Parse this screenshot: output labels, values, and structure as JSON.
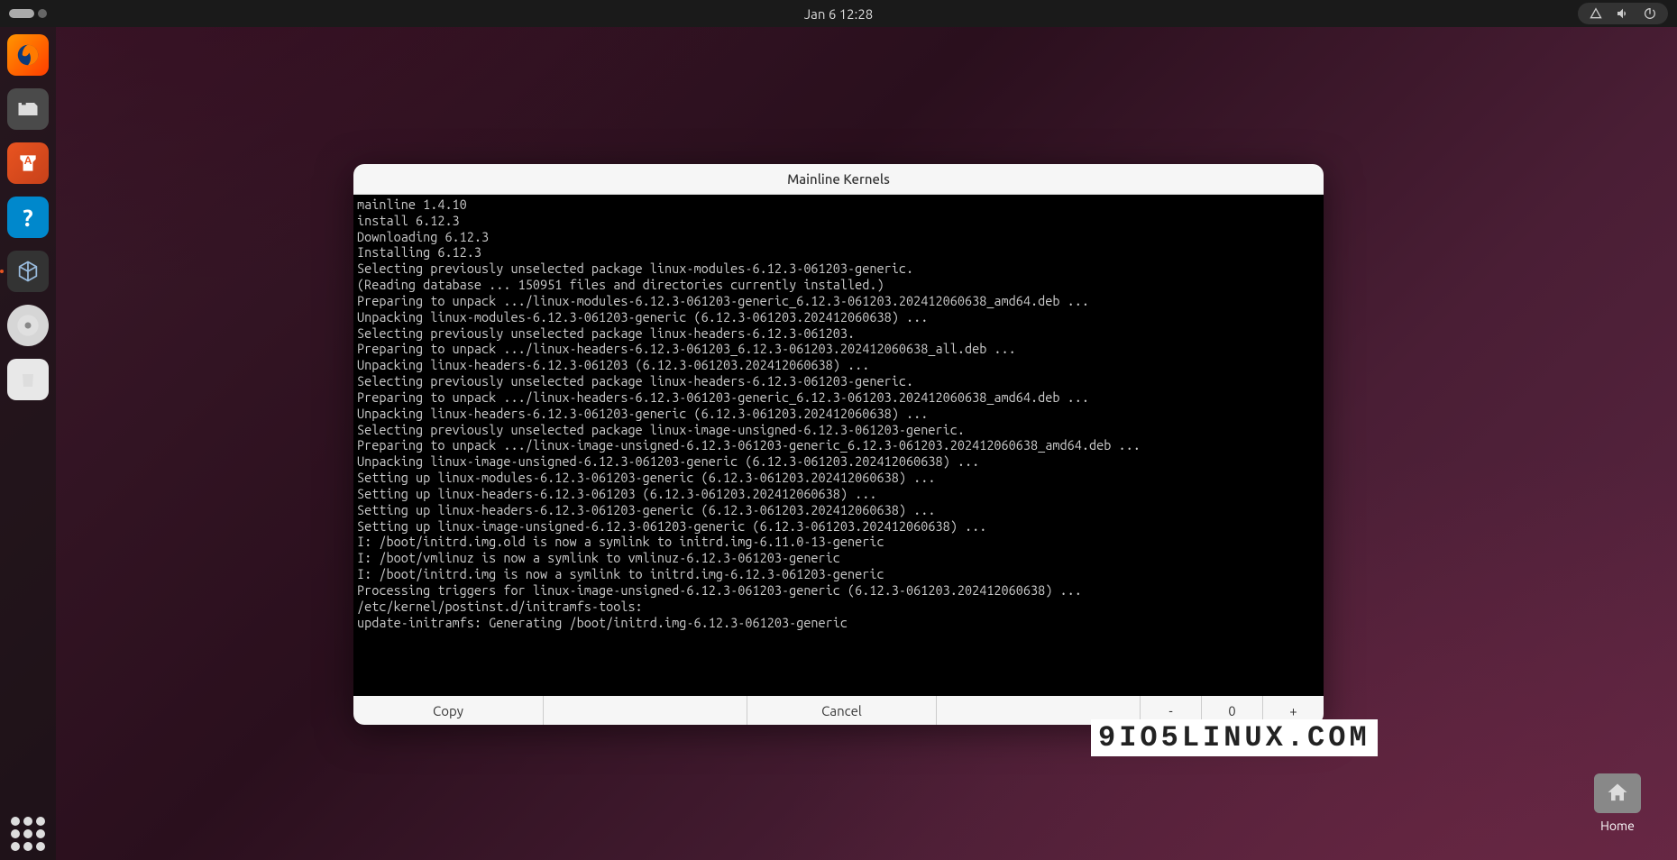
{
  "topbar": {
    "datetime": "Jan 6  12:28"
  },
  "dock": {
    "items": [
      {
        "name": "firefox",
        "glyph": "🦊"
      },
      {
        "name": "files",
        "glyph": "🗂"
      },
      {
        "name": "software",
        "glyph": "A"
      },
      {
        "name": "help",
        "glyph": "?"
      },
      {
        "name": "cube",
        "glyph": "⬚"
      },
      {
        "name": "disc",
        "glyph": "◉"
      },
      {
        "name": "trash",
        "glyph": "♻"
      }
    ]
  },
  "desktop": {
    "home_label": "Home"
  },
  "dialog": {
    "title": "Mainline Kernels",
    "buttons": {
      "copy": "Copy",
      "cancel": "Cancel",
      "minus": "-",
      "zero": "0",
      "plus": "+"
    },
    "terminal_lines": [
      "mainline 1.4.10",
      "install 6.12.3",
      "Downloading 6.12.3",
      "Installing 6.12.3",
      "Selecting previously unselected package linux-modules-6.12.3-061203-generic.",
      "(Reading database ... 150951 files and directories currently installed.)",
      "Preparing to unpack .../linux-modules-6.12.3-061203-generic_6.12.3-061203.202412060638_amd64.deb ...",
      "Unpacking linux-modules-6.12.3-061203-generic (6.12.3-061203.202412060638) ...",
      "Selecting previously unselected package linux-headers-6.12.3-061203.",
      "Preparing to unpack .../linux-headers-6.12.3-061203_6.12.3-061203.202412060638_all.deb ...",
      "Unpacking linux-headers-6.12.3-061203 (6.12.3-061203.202412060638) ...",
      "Selecting previously unselected package linux-headers-6.12.3-061203-generic.",
      "Preparing to unpack .../linux-headers-6.12.3-061203-generic_6.12.3-061203.202412060638_amd64.deb ...",
      "Unpacking linux-headers-6.12.3-061203-generic (6.12.3-061203.202412060638) ...",
      "Selecting previously unselected package linux-image-unsigned-6.12.3-061203-generic.",
      "Preparing to unpack .../linux-image-unsigned-6.12.3-061203-generic_6.12.3-061203.202412060638_amd64.deb ...",
      "Unpacking linux-image-unsigned-6.12.3-061203-generic (6.12.3-061203.202412060638) ...",
      "Setting up linux-modules-6.12.3-061203-generic (6.12.3-061203.202412060638) ...",
      "Setting up linux-headers-6.12.3-061203 (6.12.3-061203.202412060638) ...",
      "Setting up linux-headers-6.12.3-061203-generic (6.12.3-061203.202412060638) ...",
      "Setting up linux-image-unsigned-6.12.3-061203-generic (6.12.3-061203.202412060638) ...",
      "I: /boot/initrd.img.old is now a symlink to initrd.img-6.11.0-13-generic",
      "I: /boot/vmlinuz is now a symlink to vmlinuz-6.12.3-061203-generic",
      "I: /boot/initrd.img is now a symlink to initrd.img-6.12.3-061203-generic",
      "Processing triggers for linux-image-unsigned-6.12.3-061203-generic (6.12.3-061203.202412060638) ...",
      "/etc/kernel/postinst.d/initramfs-tools:",
      "update-initramfs: Generating /boot/initrd.img-6.12.3-061203-generic"
    ]
  },
  "watermark": "9IO5LINUX.COM"
}
